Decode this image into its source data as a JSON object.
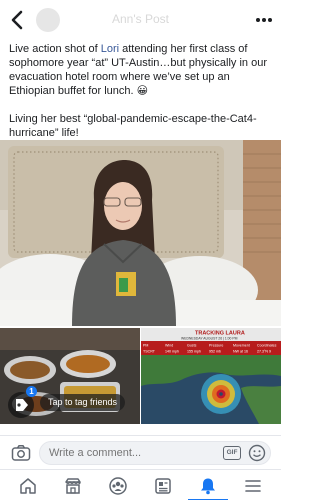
{
  "header": {
    "title": "Ann's Post",
    "back_icon": "chevron-left-icon",
    "more_icon": "more-horizontal-icon"
  },
  "post": {
    "p1_before": "Live action shot of ",
    "tagged_name": "Lori",
    "p1_after": " attending her first class of sophomore year “at” UT-Austin…but physically in our evacuation hotel room where we’ve set up an Ethiopian buffet for lunch. 😀",
    "p2": "Living her best “global-pandemic-escape-the-Cat4-hurricane” life!"
  },
  "map": {
    "banner": "TRACKING LAURA",
    "subbanner": "WEDNESDAY AUGUST 26 | 1:00 PM",
    "cols": [
      "PM",
      "Wind",
      "Gusts",
      "Pressure",
      "Movement",
      "Coordinates"
    ],
    "vals": [
      "TSCRT",
      "140 mph",
      "155 mph",
      "952 mb",
      "NW at 16",
      "27.3°N 9"
    ]
  },
  "tag_prompt": {
    "badge": "1",
    "label": "Tap to tag friends"
  },
  "comment": {
    "placeholder": "Write a comment...",
    "gif_label": "GIF"
  },
  "colors": {
    "accent": "#1877f2",
    "link": "#385898"
  },
  "tabs": [
    {
      "name": "home",
      "icon": "home-icon",
      "active": false
    },
    {
      "name": "marketplace",
      "icon": "marketplace-icon",
      "active": false
    },
    {
      "name": "groups",
      "icon": "groups-icon",
      "active": false
    },
    {
      "name": "news",
      "icon": "news-icon",
      "active": false
    },
    {
      "name": "notifications",
      "icon": "bell-icon",
      "active": true
    },
    {
      "name": "menu",
      "icon": "menu-icon",
      "active": false
    }
  ]
}
